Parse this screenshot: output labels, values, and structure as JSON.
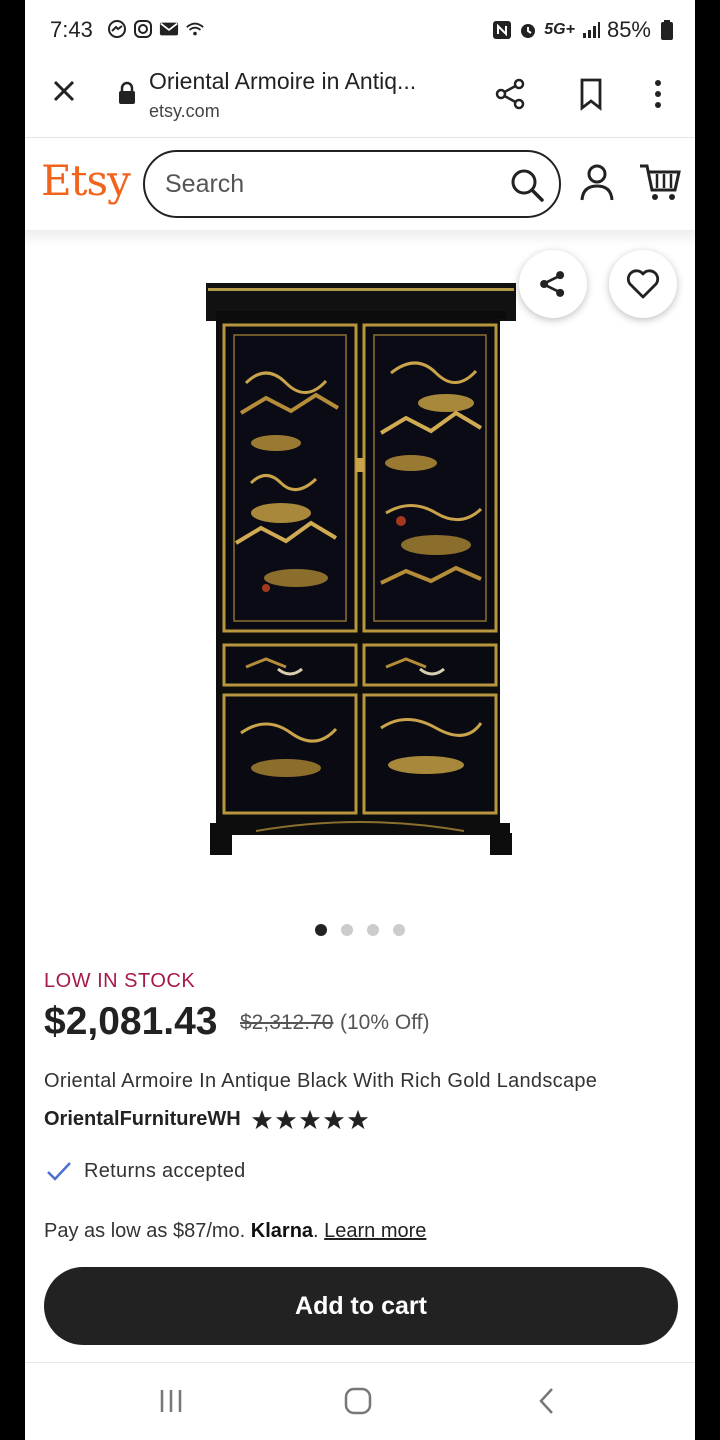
{
  "status_bar": {
    "time": "7:43",
    "network": "5G+",
    "battery": "85%"
  },
  "browser": {
    "page_title": "Oriental Armoire in Antiq...",
    "domain": "etsy.com"
  },
  "header": {
    "logo": "Etsy",
    "search_placeholder": "Search",
    "brand_color": "#f1641e"
  },
  "gallery": {
    "image_count": 4,
    "active_index": 0
  },
  "product": {
    "stock_label": "LOW IN STOCK",
    "price": "$2,081.43",
    "original_price": "$2,312.70",
    "discount": "(10% Off)",
    "title": "Oriental Armoire In Antique Black With Rich Gold Landscape",
    "shop_name": "OrientalFurnitureWH",
    "rating_stars": 5,
    "returns": "Returns accepted",
    "installment_text": "Pay as low as $87/mo.",
    "klarna": "Klarna",
    "klarna_period": ".",
    "learn_more": "Learn more",
    "add_to_cart": "Add to cart"
  }
}
